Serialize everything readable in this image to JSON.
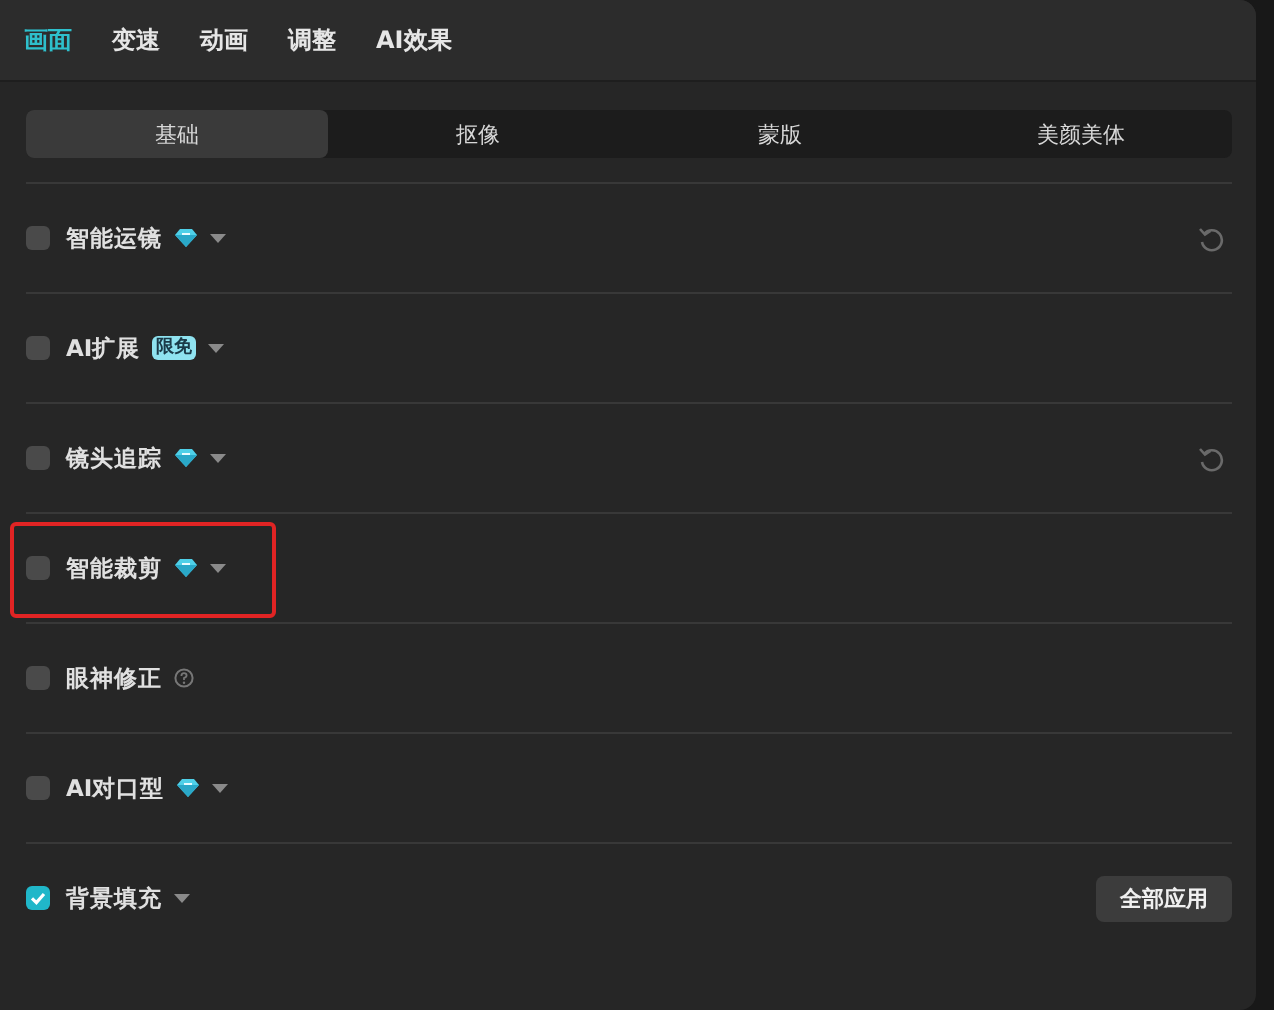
{
  "tabs": [
    {
      "label": "画面",
      "selected": true
    },
    {
      "label": "变速",
      "selected": false
    },
    {
      "label": "动画",
      "selected": false
    },
    {
      "label": "调整",
      "selected": false
    },
    {
      "label": "AI效果",
      "selected": false
    }
  ],
  "segments": [
    {
      "label": "基础",
      "selected": true
    },
    {
      "label": "抠像",
      "selected": false
    },
    {
      "label": "蒙版",
      "selected": false
    },
    {
      "label": "美颜美体",
      "selected": false
    }
  ],
  "options": [
    {
      "label": "智能运镜",
      "checked": false,
      "kind": "vip",
      "dropdown": true,
      "resettable": true,
      "highlighted": false
    },
    {
      "label": "AI扩展",
      "checked": false,
      "kind": "tag",
      "badge_text": "限免",
      "dropdown": true,
      "resettable": false,
      "highlighted": false
    },
    {
      "label": "镜头追踪",
      "checked": false,
      "kind": "vip",
      "dropdown": true,
      "resettable": true,
      "highlighted": false
    },
    {
      "label": "智能裁剪",
      "checked": false,
      "kind": "vip",
      "dropdown": true,
      "resettable": false,
      "highlighted": true
    },
    {
      "label": "眼神修正",
      "checked": false,
      "kind": "help",
      "dropdown": false,
      "resettable": false,
      "highlighted": false
    },
    {
      "label": "AI对口型",
      "checked": false,
      "kind": "vip",
      "dropdown": true,
      "resettable": false,
      "highlighted": false
    },
    {
      "label": "背景填充",
      "checked": true,
      "kind": "plain",
      "dropdown": true,
      "resettable": false,
      "highlighted": false
    }
  ],
  "apply_button": "全部应用"
}
